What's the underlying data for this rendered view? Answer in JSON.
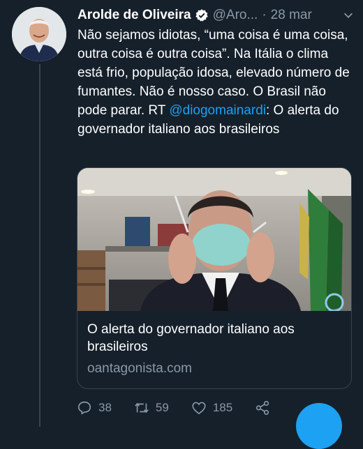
{
  "tweet": {
    "author_name": "Arolde de Oliveira",
    "handle": "@Aro...",
    "separator": "·",
    "time": "28 mar",
    "text_before": "Não sejamos idiotas, “uma coisa é uma coisa, outra coisa é outra coisa”. Na Itália o clima está frio, população idosa, elevado número de fumantes. Não é nosso caso. O Brasil não pode parar. RT ",
    "mention": "@diogomainardi",
    "text_after": ": O alerta do governador italiano aos brasileiros"
  },
  "card": {
    "title": "O alerta do governador italiano aos brasileiros",
    "domain": "oantagonista.com"
  },
  "actions": {
    "replies": "38",
    "retweets": "59",
    "likes": "185"
  },
  "colors": {
    "background": "#15202b",
    "accent": "#1da1f2",
    "secondary_text": "#8899a6",
    "border": "#38444d"
  }
}
